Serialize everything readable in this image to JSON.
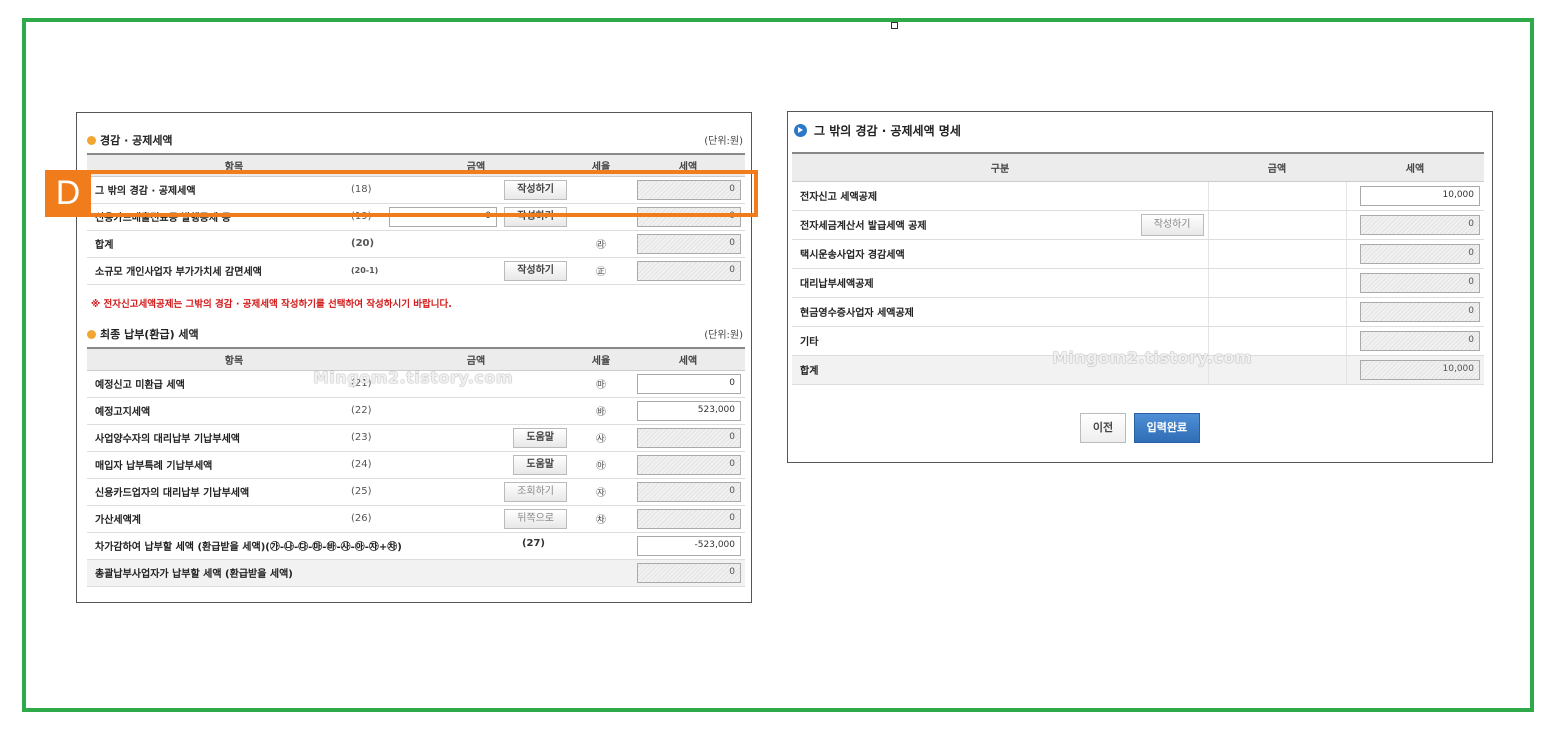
{
  "colors": {
    "frame": "#2faa4a",
    "highlight": "#f07c1c",
    "warning": "#d21a1a",
    "primary_button": "#2f6db5"
  },
  "highlight_badge": "D",
  "watermark": "Mingom2.tistory.com",
  "left": {
    "section1": {
      "title": "경감 · 공제세액",
      "unit": "(단위:원)",
      "headers": [
        "항목",
        "금액",
        "세율",
        "세액"
      ],
      "rows": [
        {
          "label": "그 밖의 경감 · 공제세액",
          "num": "(18)",
          "amount": "",
          "button": "작성하기",
          "rate": "",
          "tax": "0"
        },
        {
          "label": "신용카드매출전표등 발행공제 등",
          "num": "(19)",
          "amount": "0",
          "button": "작성하기",
          "rate": "",
          "tax": "0"
        },
        {
          "label": "합계",
          "num": "(20)",
          "amount": "",
          "button": "",
          "rate": "㉱",
          "tax": "0"
        },
        {
          "label": "소규모 개인사업자 부가가치세 감면세액",
          "num": "(20-1)",
          "amount": "",
          "button": "작성하기",
          "rate": "㊣",
          "tax": "0"
        }
      ]
    },
    "warning": "※ 전자신고세액공제는 그밖의 경감 · 공제세액 작성하기를 선택하여 작성하시기 바랍니다.",
    "section2": {
      "title": "최종 납부(환급) 세액",
      "unit": "(단위:원)",
      "headers": [
        "항목",
        "금액",
        "세율",
        "세액"
      ],
      "rows": [
        {
          "label": "예정신고 미환급 세액",
          "num": "(21)",
          "button": "",
          "rate": "㉲",
          "tax": "0"
        },
        {
          "label": "예정고지세액",
          "num": "(22)",
          "button": "",
          "rate": "㉳",
          "tax": "523,000"
        },
        {
          "label": "사업양수자의 대리납부 기납부세액",
          "num": "(23)",
          "button": "도움말",
          "rate": "㉴",
          "tax": "0"
        },
        {
          "label": "매입자 납부특례 기납부세액",
          "num": "(24)",
          "button": "도움말",
          "rate": "㉵",
          "tax": "0"
        },
        {
          "label": "신용카드업자의 대리납부 기납부세액",
          "num": "(25)",
          "button": "조회하기",
          "rate": "㉶",
          "tax": "0"
        },
        {
          "label": "가산세액계",
          "num": "(26)",
          "button": "뒤쪽으로",
          "rate": "㉷",
          "tax": "0"
        }
      ],
      "total_label": "차가감하여 납부할 세액 (환급받을 세액)(㉮-㉯-㉰-㉲-㉳-㉴-㉵-㉶+㉷)",
      "total_num": "(27)",
      "total_tax": "-523,000",
      "consolidated_label": "총괄납부사업자가 납부할 세액 (환급받을 세액)",
      "consolidated_tax": "0"
    }
  },
  "right": {
    "title": "그 밖의 경감 · 공제세액 명세",
    "headers": [
      "구분",
      "금액",
      "세액"
    ],
    "rows": [
      {
        "label": "전자신고 세액공제",
        "button": "",
        "tax": "10,000",
        "editable": true
      },
      {
        "label": "전자세금계산서 발급세액 공제",
        "button": "작성하기",
        "tax": "0",
        "editable": false
      },
      {
        "label": "택시운송사업자 경감세액",
        "button": "",
        "tax": "0",
        "editable": false
      },
      {
        "label": "대리납부세액공제",
        "button": "",
        "tax": "0",
        "editable": false
      },
      {
        "label": "현금영수증사업자 세액공제",
        "button": "",
        "tax": "0",
        "editable": false
      },
      {
        "label": "기타",
        "button": "",
        "tax": "0",
        "editable": false
      },
      {
        "label": "합계",
        "button": "",
        "tax": "10,000",
        "editable": false
      }
    ],
    "prev_button": "이전",
    "done_button": "입력완료"
  }
}
